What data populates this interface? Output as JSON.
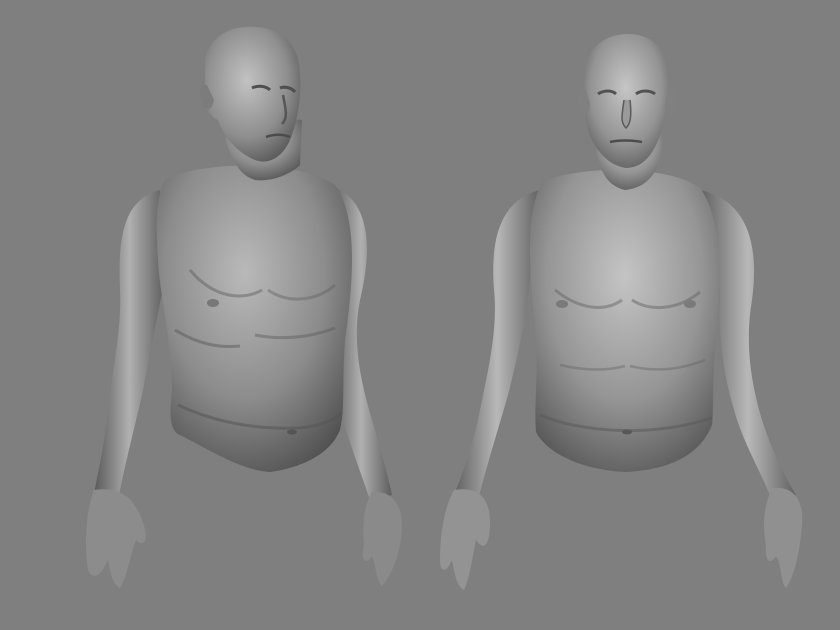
{
  "viewport": {
    "background_color": "#7f7f7f"
  },
  "models": [
    {
      "id": "sculpt-left",
      "view": "three-quarter",
      "material": "matcap-gray",
      "color": "#8a8a8a"
    },
    {
      "id": "sculpt-right",
      "view": "front",
      "material": "matcap-gray",
      "color": "#8a8a8a"
    }
  ]
}
